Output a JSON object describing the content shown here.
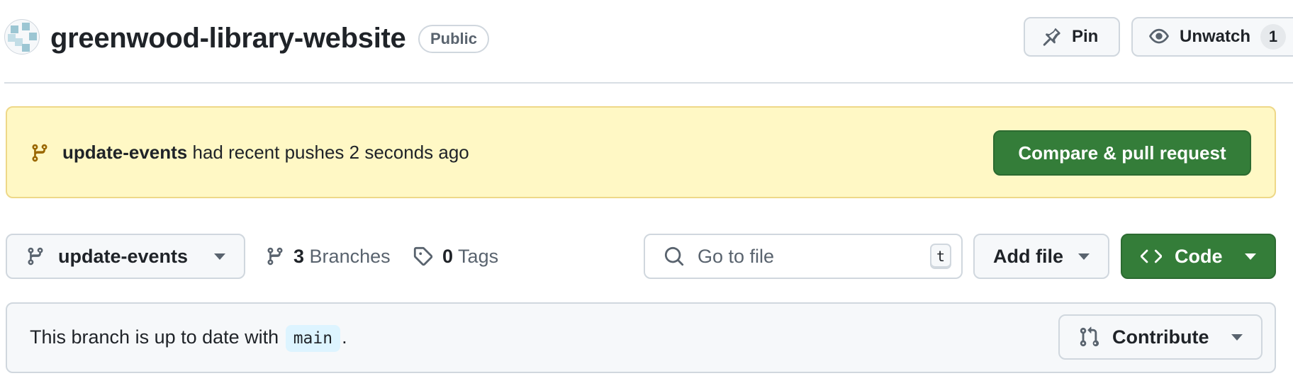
{
  "repo": {
    "name": "greenwood-library-website",
    "visibility": "Public"
  },
  "header_actions": {
    "pin_label": "Pin",
    "unwatch_label": "Unwatch",
    "watch_count": "1"
  },
  "flash": {
    "branch": "update-events",
    "message": " had recent pushes 2 seconds ago",
    "button_label": "Compare & pull request"
  },
  "toolbar": {
    "branch_select": "update-events",
    "branches_count": "3",
    "branches_label": "Branches",
    "tags_count": "0",
    "tags_label": "Tags",
    "search_placeholder": "Go to file",
    "search_shortcut": "t",
    "add_file_label": "Add file",
    "code_label": "Code"
  },
  "status": {
    "text_prefix": "This branch is up to date with ",
    "base_branch": "main",
    "text_suffix": ".",
    "contribute_label": "Contribute"
  },
  "colors": {
    "accent_green": "#347d39",
    "flash_bg": "#fff8c5",
    "branch_chip_bg": "#ddf4ff"
  },
  "icons": [
    "repo-avatar",
    "pin-icon",
    "eye-icon",
    "git-branch-icon",
    "tag-icon",
    "search-icon",
    "code-icon",
    "git-pull-request-icon",
    "triangle-down-icon"
  ]
}
